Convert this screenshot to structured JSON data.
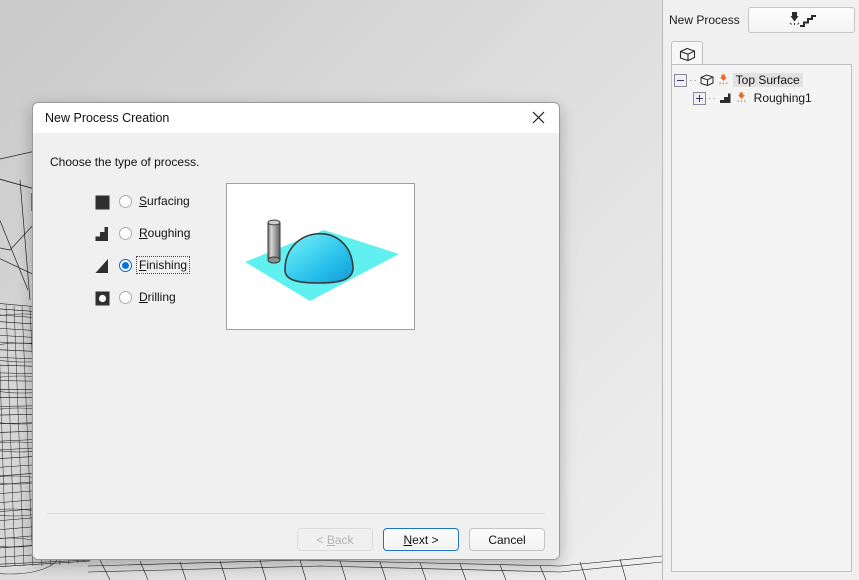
{
  "viewport": {
    "name": "3d-model-viewport",
    "description": "wireframe-mesh-model"
  },
  "cursor": {
    "icon": "mouse-pointer-icon"
  },
  "right_panel": {
    "process_label": "New Process",
    "new_process_button": {
      "icon": "milling-tool-step-icon",
      "tooltip": "New Process"
    },
    "tab": {
      "icon": "solid-box-icon",
      "label": ""
    },
    "tree": [
      {
        "label": "Top Surface",
        "expander": "minus",
        "type_icon": "solid-box-icon",
        "tool_icon": "orange-tool-icon",
        "selected": true,
        "level": 0
      },
      {
        "label": "Roughing1",
        "expander": "plus",
        "type_icon": "roughing-step-icon",
        "tool_icon": "orange-tool-icon",
        "selected": false,
        "level": 1
      }
    ]
  },
  "dialog": {
    "title": "New Process Creation",
    "close_icon": "close-icon",
    "prompt": "Choose the type of process.",
    "options": [
      {
        "label": "Surfacing",
        "accel": "S",
        "icon": "surfacing-square-icon",
        "checked": false,
        "focused": false
      },
      {
        "label": "Roughing",
        "accel": "R",
        "icon": "roughing-step-icon",
        "checked": false,
        "focused": false
      },
      {
        "label": "Finishing",
        "accel": "F",
        "icon": "finishing-ramp-icon",
        "checked": true,
        "focused": true
      },
      {
        "label": "Drilling",
        "accel": "D",
        "icon": "drilling-hole-icon",
        "checked": false,
        "focused": false
      }
    ],
    "preview": {
      "name": "process-preview-image",
      "alt": "finishing-dome-on-plane-illustration",
      "plane_color": "#5ff0ef",
      "dome_color": "#2ec8ef",
      "tool_color": "#9a9a9a"
    },
    "buttons": {
      "back": {
        "label": "< Back",
        "accel": "B",
        "disabled": true,
        "default": false
      },
      "next": {
        "label": "Next >",
        "accel": "N",
        "disabled": false,
        "default": true
      },
      "cancel": {
        "label": "Cancel",
        "accel": "",
        "disabled": false,
        "default": false
      }
    }
  },
  "colors": {
    "accent": "#0b70d8",
    "default_button_border": "#1b73c4",
    "panel_bg": "#f0f0f0",
    "tool_orange": "#ef6a21"
  }
}
